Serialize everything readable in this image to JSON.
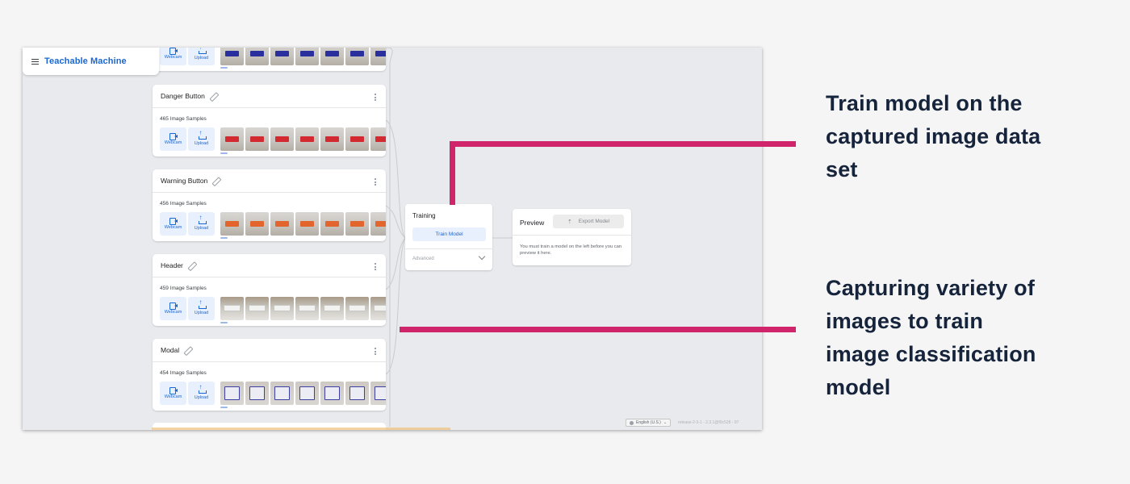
{
  "app": {
    "title": "Teachable Machine"
  },
  "capture_buttons": {
    "webcam_label": "Webcam",
    "upload_label": "Upload"
  },
  "classes": [
    {
      "name": "",
      "samples_label": "",
      "sample_color": "#2a2f9e"
    },
    {
      "name": "Danger Button",
      "samples_label": "465 Image Samples",
      "sample_color": "#d32a32"
    },
    {
      "name": "Warning Button",
      "samples_label": "456 Image Samples",
      "sample_color": "#e2652e"
    },
    {
      "name": "Header",
      "samples_label": "459 Image Samples",
      "sample_color": "#f2f2f0"
    },
    {
      "name": "Modal",
      "samples_label": "454 Image Samples",
      "sample_color": "#3d3fa0"
    }
  ],
  "training": {
    "title": "Training",
    "train_button": "Train Model",
    "advanced_label": "Advanced"
  },
  "preview": {
    "title": "Preview",
    "export_button": "Export Model",
    "message": "You must train a model on the left before you can preview it here."
  },
  "footer": {
    "language": "English (U.S.)",
    "release": "release-2-3-1 - 2.3.1@f0c528 - 97"
  },
  "annotations": {
    "train_note": [
      "Train model on the",
      "captured image data",
      "set"
    ],
    "capture_note": [
      "Capturing variety of",
      "images to train",
      "image classification",
      "model"
    ]
  },
  "colors": {
    "accent": "#1967d2",
    "callout": "#d0246b",
    "annotation_text": "#15233b"
  }
}
